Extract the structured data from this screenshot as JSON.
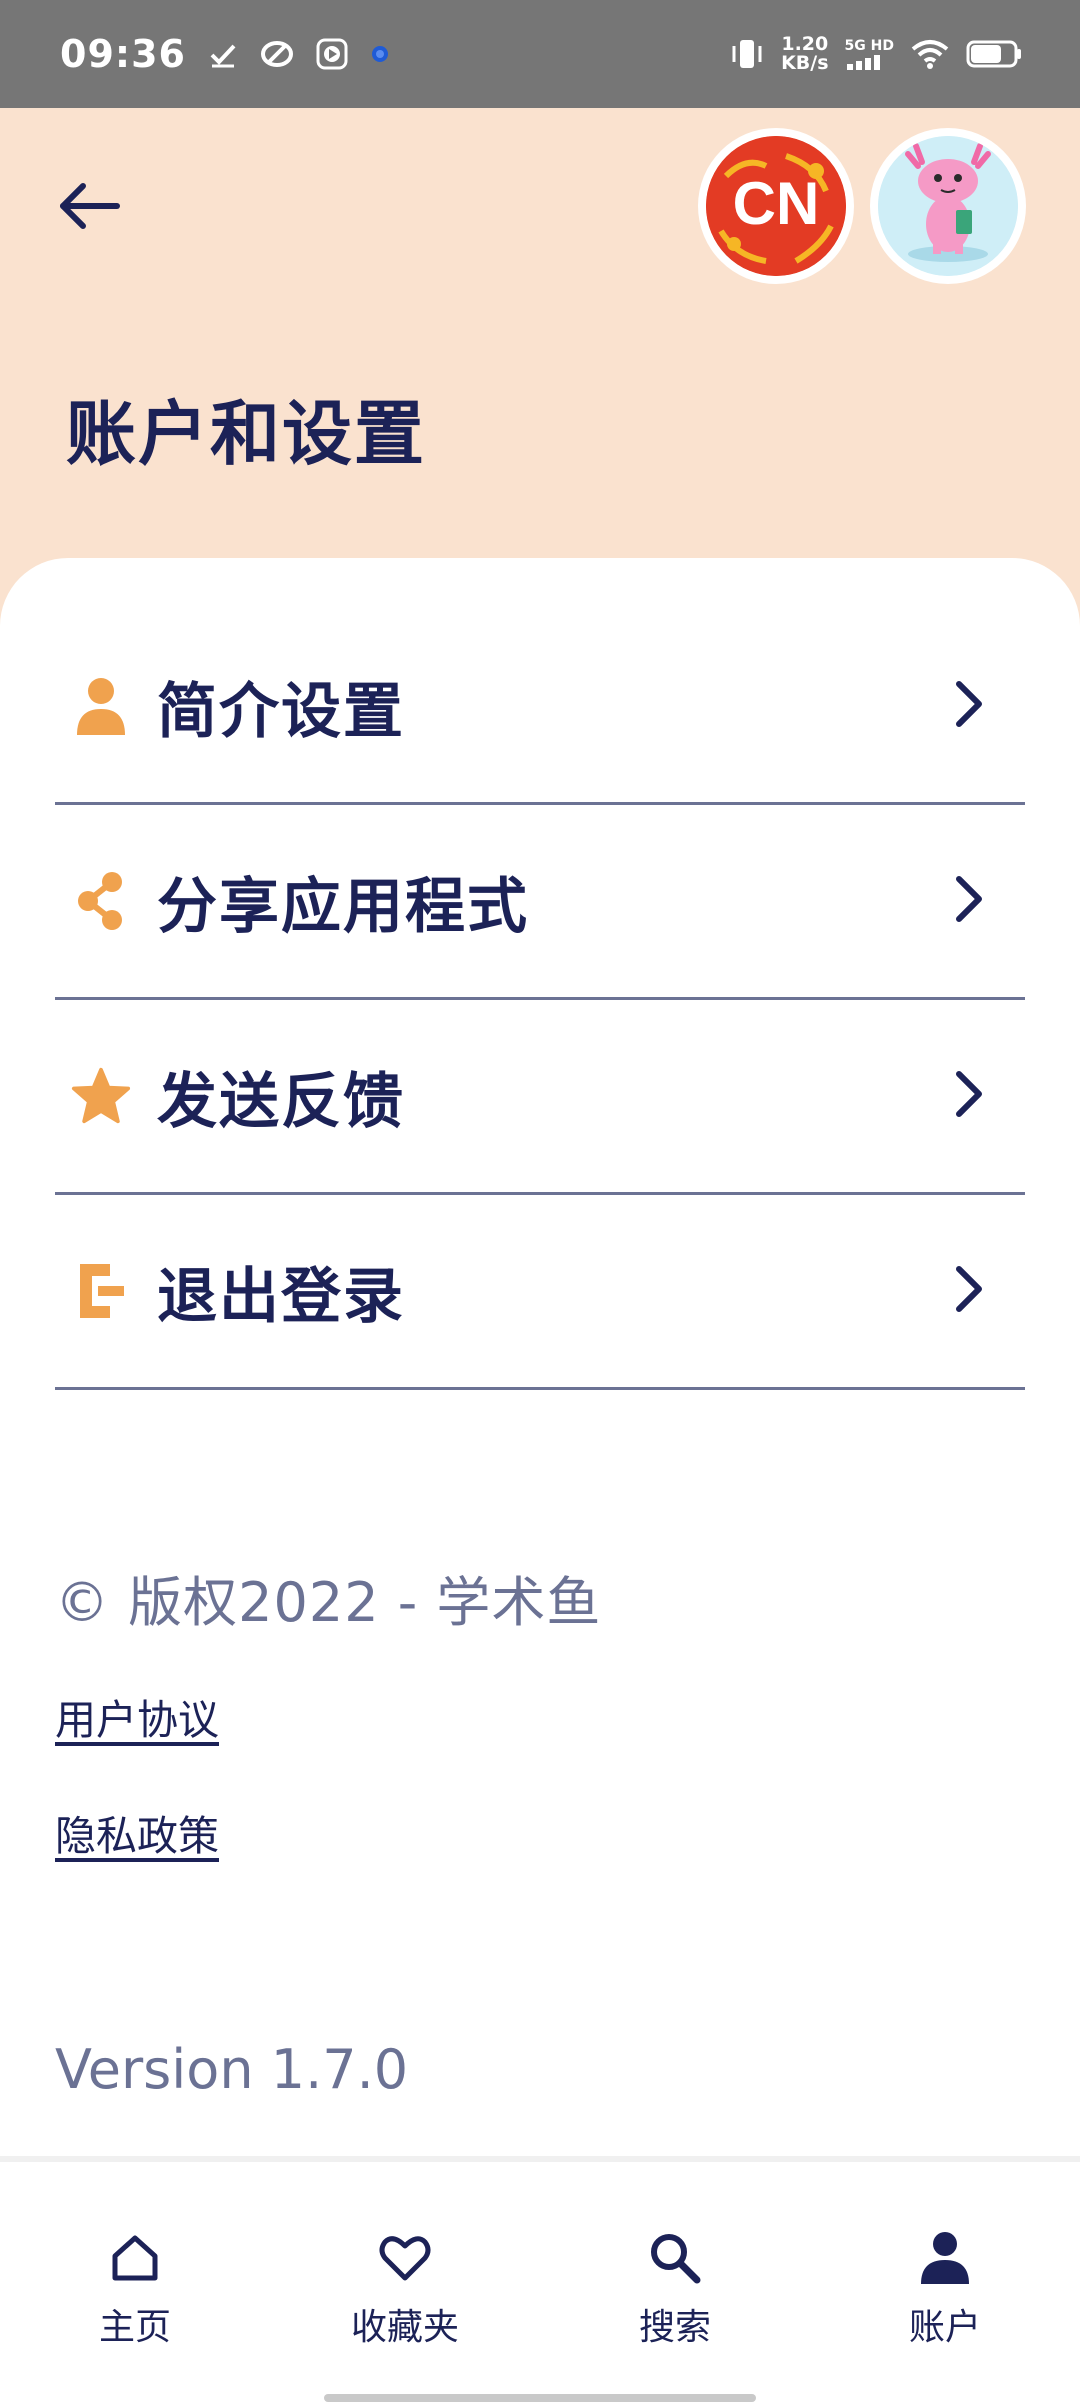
{
  "status_bar": {
    "time": "09:36",
    "net_speed_value": "1.20",
    "net_speed_unit": "KB/s",
    "net_type": "5G HD",
    "icons": [
      "download-done-icon",
      "sync-icon",
      "play-icon",
      "notification-dot-icon",
      "vibrate-icon",
      "signal-icon",
      "wifi-icon",
      "battery-icon"
    ]
  },
  "header": {
    "title": "账户和设置",
    "back_icon": "arrow-left-icon",
    "language_badge": "CN",
    "background_color": "#fae2cf"
  },
  "menu": {
    "items": [
      {
        "label": "简介设置",
        "icon": "person-icon"
      },
      {
        "label": "分享应用程式",
        "icon": "share-icon"
      },
      {
        "label": "发送反馈",
        "icon": "star-icon"
      },
      {
        "label": "退出登录",
        "icon": "logout-icon"
      }
    ],
    "icon_color": "#f0a24e"
  },
  "footer": {
    "copyright": "©  版权2022 - 学术鱼",
    "terms_link": "用户协议",
    "privacy_link": "隐私政策",
    "version": "Version 1.7.0"
  },
  "bottom_nav": {
    "items": [
      {
        "label": "主页",
        "icon": "home-icon"
      },
      {
        "label": "收藏夹",
        "icon": "heart-icon"
      },
      {
        "label": "搜索",
        "icon": "search-icon"
      },
      {
        "label": "账户",
        "icon": "account-icon",
        "active": true
      }
    ]
  },
  "colors": {
    "primary": "#1c2257",
    "muted": "#6b7294",
    "accent": "#f0a24e"
  }
}
